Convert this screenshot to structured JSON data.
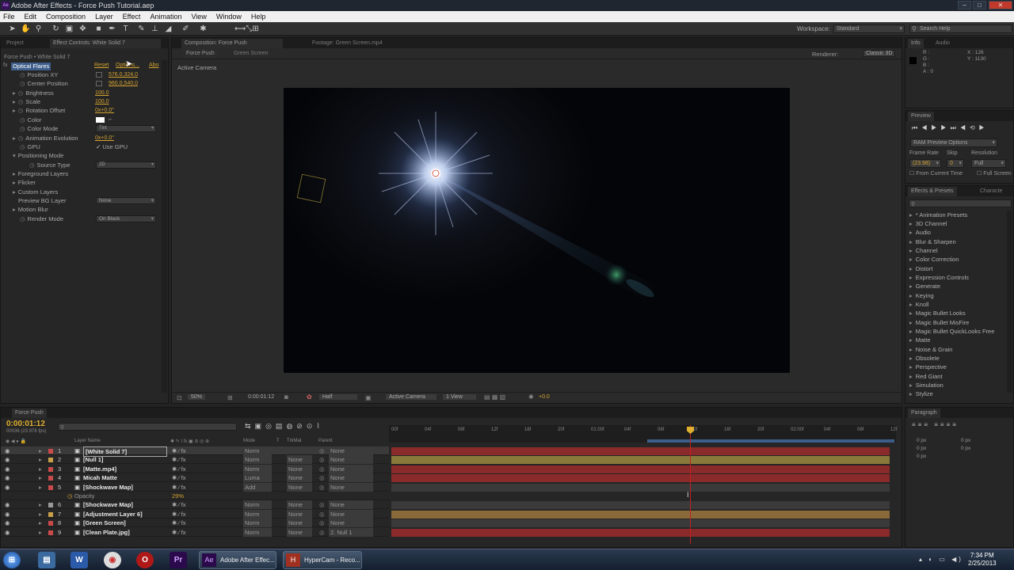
{
  "window": {
    "title": "Adobe After Effects - Force Push Tutorial.aep",
    "app_icon": "Ae"
  },
  "menu": [
    "File",
    "Edit",
    "Composition",
    "Layer",
    "Effect",
    "Animation",
    "View",
    "Window",
    "Help"
  ],
  "toolbar": {
    "workspace_label": "Workspace:",
    "workspace_value": "Standard",
    "search_placeholder": "Search Help"
  },
  "effect_controls": {
    "tabs": [
      "Project",
      "Effect Controls: White Solid 7"
    ],
    "breadcrumb": "Force Push • White Solid 7",
    "effect_name": "Optical Flares",
    "reset": "Reset",
    "options": "Options...",
    "about": "Abo",
    "props": [
      {
        "label": "Position XY",
        "value": "576.0,324.0"
      },
      {
        "label": "Center Position",
        "value": "960.0,540.0"
      },
      {
        "label": "Brightness",
        "value": "100.0"
      },
      {
        "label": "Scale",
        "value": "100.0"
      },
      {
        "label": "Rotation Offset",
        "value": "0x+0.0°"
      },
      {
        "label": "Color",
        "value": ""
      },
      {
        "label": "Color Mode",
        "value": "Tint"
      },
      {
        "label": "Animation Evolution",
        "value": "0x+0.0°"
      },
      {
        "label": "GPU",
        "value": "Use GPU"
      },
      {
        "label": "Positioning Mode",
        "value": ""
      },
      {
        "label": "Source Type",
        "value": "2D"
      },
      {
        "label": "Foreground Layers",
        "value": ""
      },
      {
        "label": "Flicker",
        "value": ""
      },
      {
        "label": "Custom Layers",
        "value": ""
      },
      {
        "label": "Preview BG Layer",
        "value": "None"
      },
      {
        "label": "Motion Blur",
        "value": ""
      },
      {
        "label": "Render Mode",
        "value": "On Black"
      }
    ]
  },
  "composition": {
    "tabs": [
      "Composition: Force Push",
      "Footage: Green Screen.mp4"
    ],
    "subtabs": [
      "Force Push",
      "Green Screen"
    ],
    "renderer_label": "Renderer:",
    "renderer": "Classic 3D",
    "view_label": "Active Camera",
    "zoom": "50%",
    "timecode": "0:00:01:12",
    "resolution": "Half",
    "camera": "Active Camera",
    "views": "1 View",
    "exposure": "+0.0"
  },
  "info": {
    "tabs": [
      "Info",
      "Audio"
    ],
    "r": "R :",
    "g": "G :",
    "b": "B :",
    "a": "A : 0",
    "x": "X : 126",
    "y": "Y : 1130"
  },
  "preview": {
    "title": "Preview",
    "ram_options": "RAM Preview Options",
    "frame_rate_label": "Frame Rate",
    "skip_label": "Skip",
    "resolution_label": "Resolution",
    "frame_rate": "(23.98)",
    "skip": "0",
    "resolution": "Full",
    "from_current": "From Current Time",
    "full_screen": "Full Screen"
  },
  "effects_presets": {
    "tabs": [
      "Effects & Presets",
      "Characte"
    ],
    "items": [
      "* Animation Presets",
      "3D Channel",
      "Audio",
      "Blur & Sharpen",
      "Channel",
      "Color Correction",
      "Distort",
      "Expression Controls",
      "Generate",
      "Keying",
      "Knoll",
      "Magic Bullet Looks",
      "Magic Bullet MisFire",
      "Magic Bullet QuickLooks Free",
      "Matte",
      "Noise & Grain",
      "Obsolete",
      "Perspective",
      "Red Giant",
      "Simulation",
      "Stylize"
    ]
  },
  "paragraph": {
    "title": "Paragraph",
    "px": [
      "0 px",
      "0 px",
      "0 px",
      "0 px",
      "0 px"
    ]
  },
  "timeline": {
    "tab": "Force Push",
    "timecode": "0:00:01:12",
    "fps": "00036 (23.976 fps)",
    "col_layer": "Layer Name",
    "col_mode": "Mode",
    "col_t": "T",
    "col_trkmat": "TrkMat",
    "col_parent": "Parent",
    "ruler": [
      "00f",
      "04f",
      "08f",
      "12f",
      "16f",
      "20f",
      "01:00f",
      "04f",
      "08f",
      "12f",
      "16f",
      "20f",
      "02:00f",
      "04f",
      "08f",
      "12f"
    ],
    "layers": [
      {
        "num": "1",
        "name": "[White Solid 7]",
        "mode": "Norm",
        "trkmat": "",
        "parent": "None",
        "color": "#c94a4a"
      },
      {
        "num": "2",
        "name": "[Null 1]",
        "mode": "Norm",
        "trkmat": "None",
        "parent": "None",
        "color": "#c9a04a"
      },
      {
        "num": "3",
        "name": "[Matte.mp4]",
        "mode": "Norm",
        "trkmat": "None",
        "parent": "None",
        "color": "#c94a4a"
      },
      {
        "num": "4",
        "name": "Micah Matte",
        "mode": "Luma",
        "trkmat": "None",
        "parent": "None",
        "color": "#c94a4a"
      },
      {
        "num": "5",
        "name": "[Shockwave Map]",
        "mode": "Add",
        "trkmat": "None",
        "parent": "None",
        "color": "#c94a4a"
      },
      {
        "num": "",
        "name": "Opacity",
        "mode": "",
        "trkmat": "",
        "parent": "",
        "color": ""
      },
      {
        "num": "6",
        "name": "[Shockwave Map]",
        "mode": "Norm",
        "trkmat": "None",
        "parent": "None",
        "color": "#9a9a9a"
      },
      {
        "num": "7",
        "name": "[Adjustment Layer 6]",
        "mode": "Norm",
        "trkmat": "None",
        "parent": "None",
        "color": "#c9a04a"
      },
      {
        "num": "8",
        "name": "[Green Screen]",
        "mode": "Norm",
        "trkmat": "None",
        "parent": "None",
        "color": "#c94a4a"
      },
      {
        "num": "9",
        "name": "[Clean Plate.jpg]",
        "mode": "Norm",
        "trkmat": "None",
        "parent": "2. Null 1",
        "color": "#c94a4a"
      }
    ],
    "opacity_value": "29%"
  },
  "taskbar": {
    "apps": [
      "Adobe After Effec...",
      "HyperCam - Reco..."
    ],
    "time": "7:34 PM",
    "date": "2/25/2013"
  }
}
